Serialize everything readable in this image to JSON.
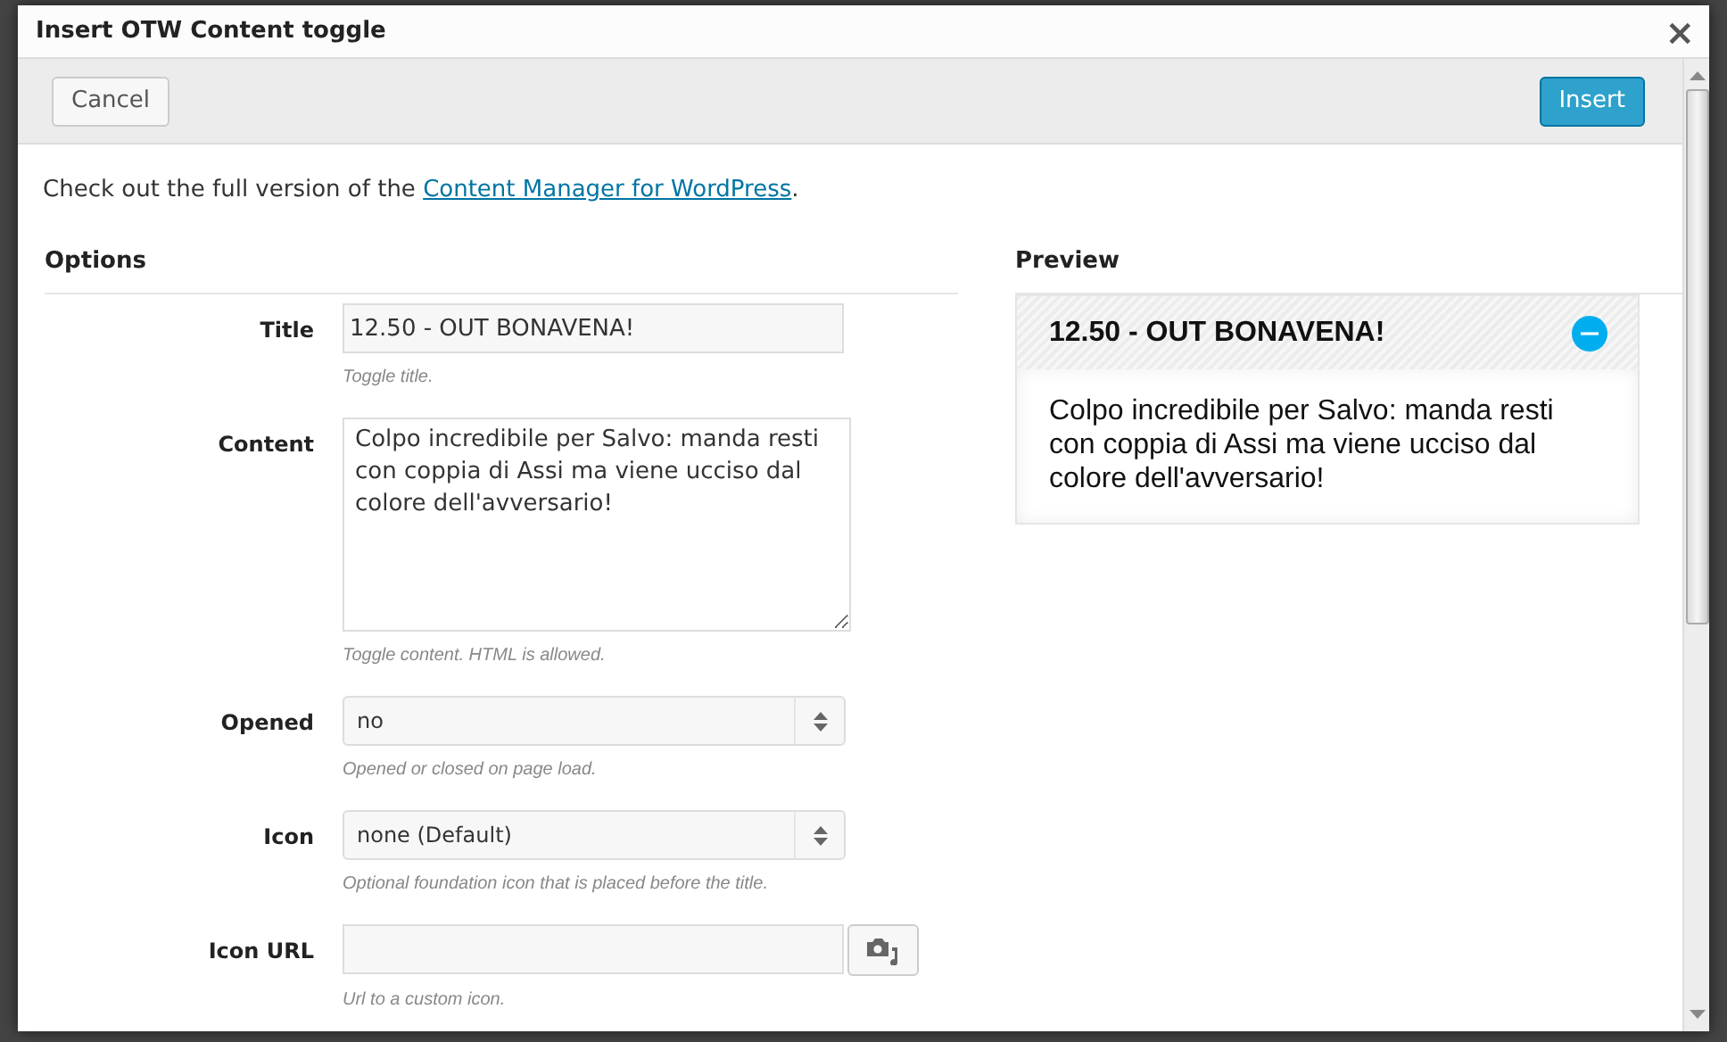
{
  "dialog": {
    "title": "Insert OTW Content toggle",
    "close": "×"
  },
  "toolbar": {
    "buttons": [
      {
        "label": "Cancel",
        "kind": "secondary"
      },
      {
        "label": "Insert",
        "kind": "primary"
      }
    ]
  },
  "notice": {
    "text": "Check out the full version of the ",
    "link": "Content Manager for WordPress",
    "after": "."
  },
  "options": {
    "heading": "Options",
    "fields": [
      {
        "kind": "text",
        "label": "Title",
        "value": "12.50 - OUT BONAVENA!",
        "help": "Toggle title."
      },
      {
        "kind": "textarea",
        "label": "Content",
        "value": "Colpo incredibile per Salvo: manda resti con coppia di Assi ma viene ucciso dal colore dell'avversario!",
        "help": "Toggle content. HTML is allowed."
      },
      {
        "kind": "select",
        "label": "Opened",
        "value": "no",
        "help": "Opened or closed on page load."
      },
      {
        "kind": "select",
        "label": "Icon",
        "value": "none (Default)",
        "help": "Optional foundation icon that is placed before the title."
      },
      {
        "kind": "media",
        "label": "Icon URL",
        "help": "Url to a custom icon."
      }
    ]
  },
  "preview": {
    "heading": "Preview",
    "title": "12.50 - OUT BONAVENA!",
    "content": "Colpo incredibile per Salvo: manda resti con coppia di Assi ma viene ucciso dal colore dell'avversario!",
    "expanded": true
  }
}
